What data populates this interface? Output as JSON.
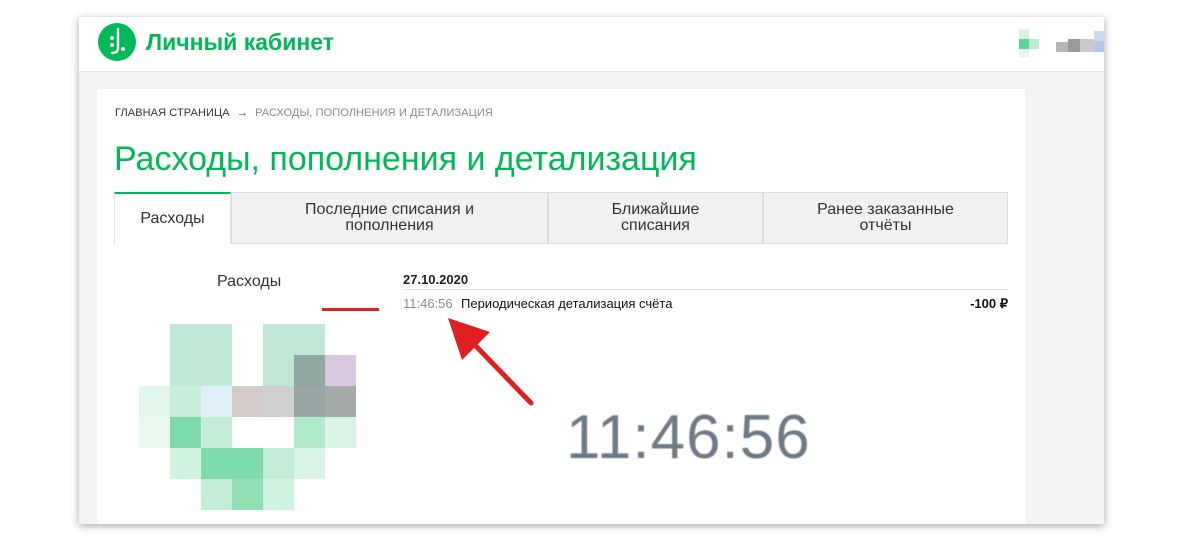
{
  "header": {
    "brand": "Личный кабинет"
  },
  "breadcrumb": {
    "home": "ГЛАВНАЯ СТРАНИЦА",
    "arrow": "→",
    "current": "РАСХОДЫ, ПОПОЛНЕНИЯ И ДЕТАЛИЗАЦИЯ"
  },
  "page_title": "Расходы, пополнения и детализация",
  "tabs": [
    {
      "label": "Расходы",
      "active": true
    },
    {
      "label": "Последние списания и пополнения",
      "active": false
    },
    {
      "label": "Ближайшие списания",
      "active": false
    },
    {
      "label": "Ранее заказанные отчёты",
      "active": false
    }
  ],
  "sidebar": {
    "title": "Расходы"
  },
  "transactions": {
    "date": "27.10.2020",
    "items": [
      {
        "time": "11:46:56",
        "description": "Периодическая детализация счёта",
        "amount": "-100 ₽"
      }
    ]
  },
  "annotation": {
    "zoomed_time": "11:46:56",
    "color": "#e02020"
  },
  "colors": {
    "brand": "#00b956",
    "arrow": "#e02020"
  }
}
